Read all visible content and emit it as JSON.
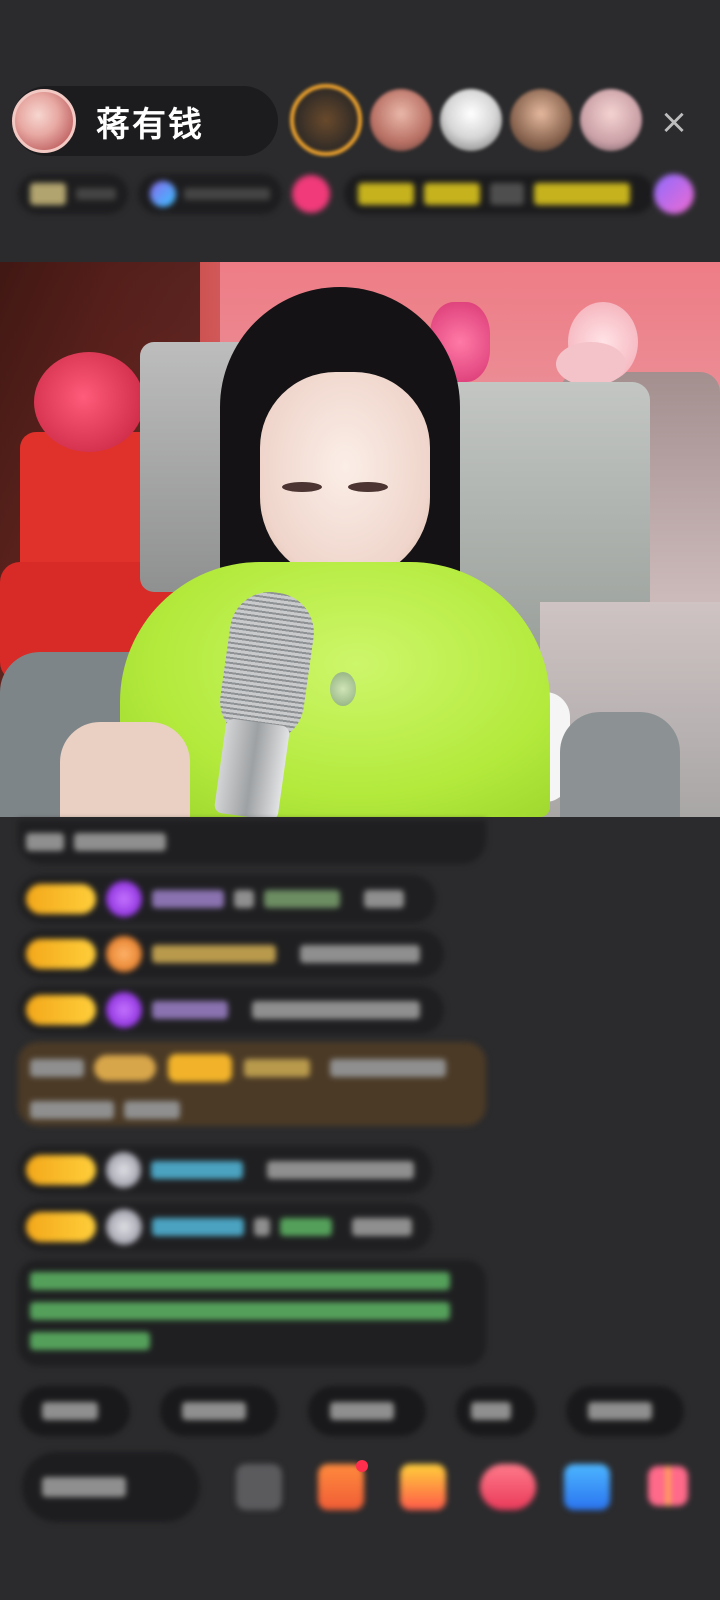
{
  "header": {
    "host_name": "蒋有钱",
    "close_icon": "×",
    "viewers_icons": [
      "viewer-avatar",
      "viewer-avatar",
      "viewer-avatar",
      "viewer-avatar",
      "viewer-avatar"
    ]
  },
  "info_row": {
    "icons": [
      "badge-icon",
      "hot-icon",
      "pink-dot-icon",
      "rank-icon",
      "purple-gift-icon"
    ]
  },
  "video": {
    "icon": "live-video-feed"
  },
  "chat": {
    "messages": [
      {
        "icon": "gem-purple-icon"
      },
      {
        "icon": "gem-orange-icon"
      },
      {
        "icon": "gem-purple-icon"
      },
      {
        "icon": "badge-highlight-icon"
      },
      {
        "icon": "gem-gray-icon"
      },
      {
        "icon": "gem-gray-icon"
      }
    ]
  },
  "colors": {
    "background": "#2b2b2d",
    "accent_yellow": "#ffce3a",
    "accent_pink": "#f03a79",
    "accent_purple": "#8e6cff"
  },
  "bottom_toolbar": {
    "icons": [
      "emoji-icon",
      "gift-box-icon",
      "treasure-icon",
      "heart-icon",
      "game-icon",
      "more-grid-icon"
    ]
  }
}
